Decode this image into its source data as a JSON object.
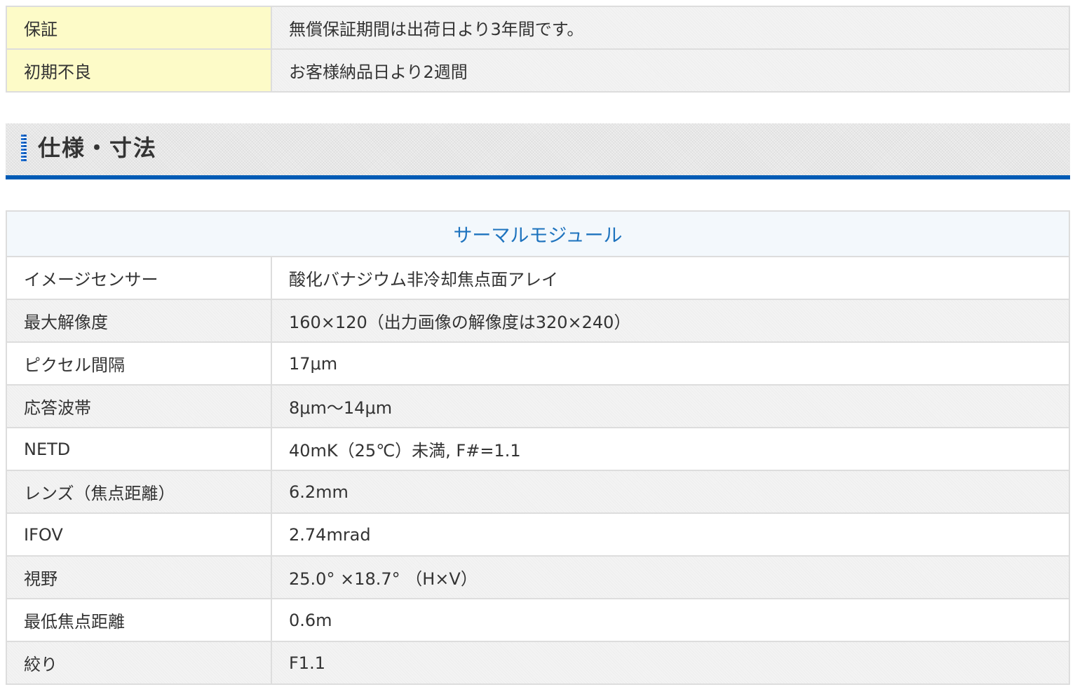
{
  "warranty": {
    "rows": [
      {
        "label": "保証",
        "value": "無償保証期間は出荷日より3年間です。"
      },
      {
        "label": "初期不良",
        "value": "お客様納品日より2週間"
      }
    ]
  },
  "section": {
    "title": "仕様・寸法"
  },
  "spec_table": {
    "caption": "サーマルモジュール",
    "rows": [
      {
        "label": "イメージセンサー",
        "value": "酸化バナジウム非冷却焦点面アレイ"
      },
      {
        "label": "最大解像度",
        "value": "160×120（出力画像の解像度は320×240）"
      },
      {
        "label": "ピクセル間隔",
        "value": "17μm"
      },
      {
        "label": "応答波帯",
        "value": "8μm～14μm"
      },
      {
        "label": "NETD",
        "value": "40mK（25℃）未満, F#=1.1"
      },
      {
        "label": "レンズ（焦点距離）",
        "value": "6.2mm"
      },
      {
        "label": "IFOV",
        "value": "2.74mrad"
      },
      {
        "label": "視野",
        "value": "25.0° ×18.7° （H×V）"
      },
      {
        "label": "最低焦点距離",
        "value": "0.6m"
      },
      {
        "label": "絞り",
        "value": "F1.1"
      }
    ]
  }
}
